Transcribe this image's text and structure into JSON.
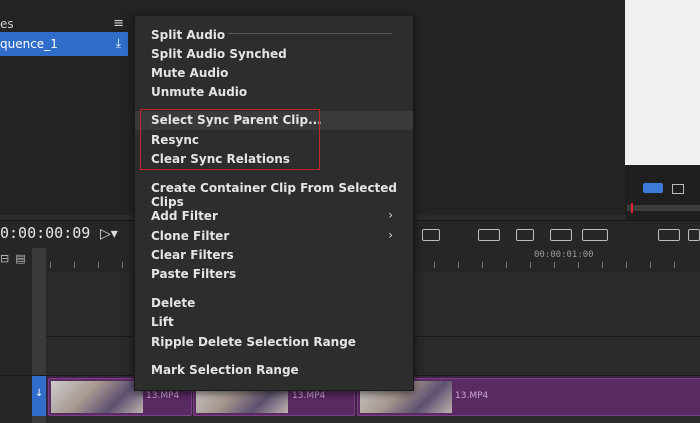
{
  "project_panel": {
    "title": "es",
    "menu_glyph": "≡",
    "selected_item": "quence_1",
    "item_icon": "download-icon"
  },
  "timeline": {
    "timecode": "0:00:00:09",
    "cursor_glyph": "▷▾",
    "ruler_time": "00:00:01:00",
    "ruler_icons": "⊟▤⌂",
    "track_marker_glyph": "↓",
    "clips": [
      {
        "label": "13.MP4"
      },
      {
        "label": "13.MP4"
      },
      {
        "label": "13.MP4"
      }
    ]
  },
  "context_menu": {
    "items": [
      {
        "label": "Split Audio"
      },
      {
        "label": "Split Audio Synched"
      },
      {
        "label": "Mute Audio"
      },
      {
        "label": "Unmute Audio"
      },
      {
        "label": "Select Sync Parent Clip..."
      },
      {
        "label": "Resync"
      },
      {
        "label": "Clear Sync Relations"
      },
      {
        "label": "Create Container Clip From Selected Clips"
      },
      {
        "label": "Add Filter",
        "submenu": "›"
      },
      {
        "label": "Clone Filter",
        "submenu": "›"
      },
      {
        "label": "Clear Filters"
      },
      {
        "label": "Paste Filters"
      },
      {
        "label": "Delete"
      },
      {
        "label": "Lift"
      },
      {
        "label": "Ripple Delete Selection Range"
      },
      {
        "label": "Mark Selection Range"
      }
    ]
  },
  "colors": {
    "accent": "#2f6dc9",
    "highlight_border": "#c0262a",
    "clip": "#5a2a63"
  }
}
